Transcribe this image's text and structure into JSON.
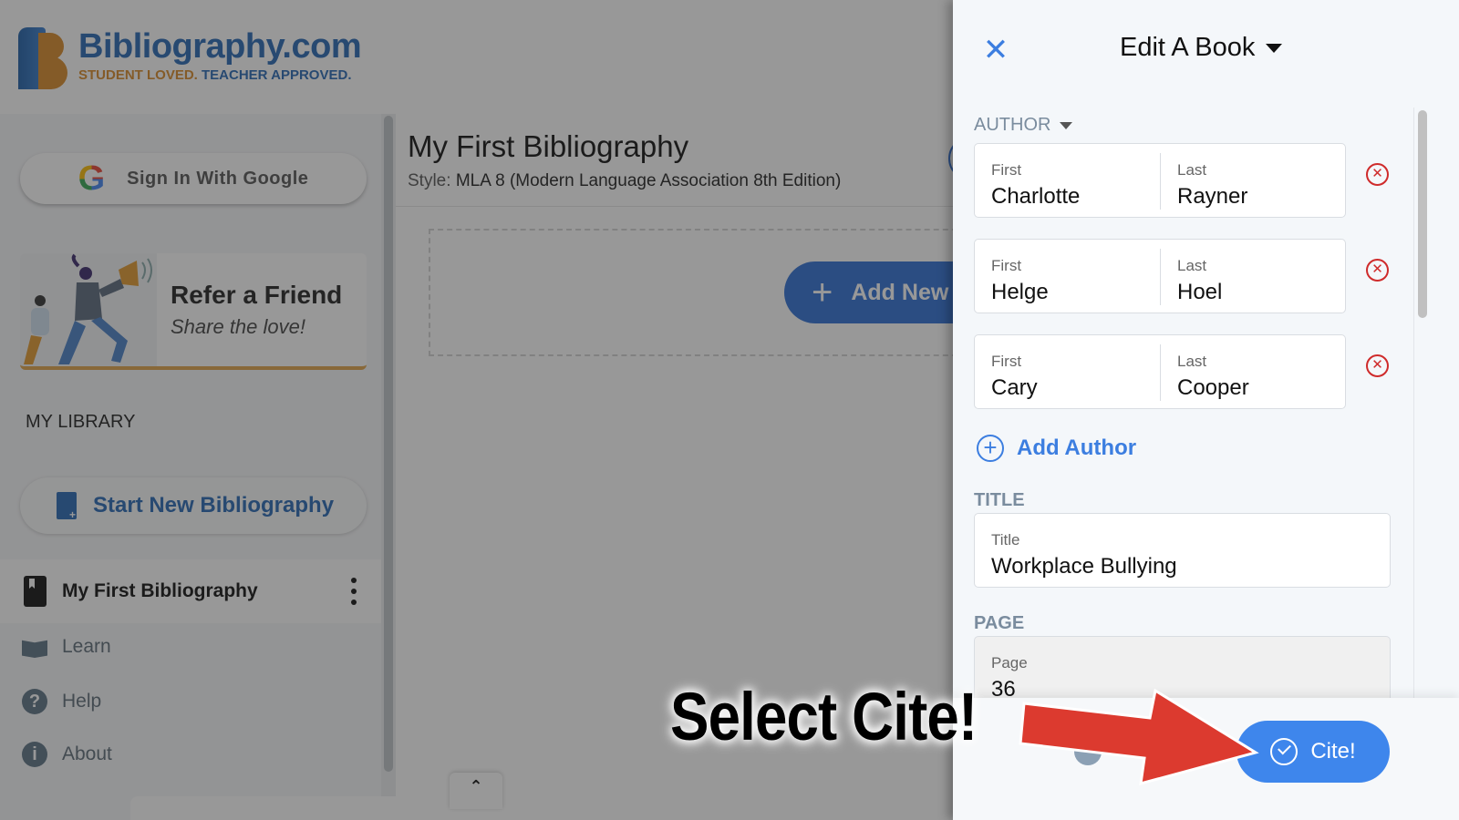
{
  "header": {
    "logo_title": "Bibliography.com",
    "logo_tagline_part1": "STUDENT LOVED.",
    "logo_tagline_part2": "TEACHER APPROVED."
  },
  "sidebar": {
    "google_signin_label": "Sign In With Google",
    "refer": {
      "title": "Refer a Friend",
      "subtitle": "Share the love!"
    },
    "library_label": "MY LIBRARY",
    "start_new_label": "Start New Bibliography",
    "bibliographies": [
      {
        "label": "My First Bibliography"
      }
    ],
    "nav": [
      {
        "label": "Learn",
        "icon": "book-reader-icon"
      },
      {
        "label": "Help",
        "icon": "question-circle-icon",
        "glyph": "?"
      },
      {
        "label": "About",
        "icon": "info-circle-icon",
        "glyph": "i"
      }
    ]
  },
  "main": {
    "title": "My First Bibliography",
    "style_key": "Style:",
    "style_value": "MLA 8 (Modern Language Association 8th Edition)",
    "add_new_label": "Add New Citation",
    "add_new_icon": "+",
    "scroll_top_glyph": "⌃"
  },
  "panel": {
    "close_glyph": "✕",
    "title": "Edit A Book",
    "author_section_label": "AUTHOR",
    "authors": [
      {
        "first_label": "First",
        "first": "Charlotte",
        "last_label": "Last",
        "last": "Rayner"
      },
      {
        "first_label": "First",
        "first": "Helge",
        "last_label": "Last",
        "last": "Hoel"
      },
      {
        "first_label": "First",
        "first": "Cary",
        "last_label": "Last",
        "last": "Cooper"
      }
    ],
    "remove_glyph": "✕",
    "add_author_label": "Add Author",
    "add_author_glyph": "+",
    "title_section_label": "TITLE",
    "title_field_label": "Title",
    "title_value": "Workplace Bullying",
    "page_section_label": "PAGE",
    "page_field_label": "Page",
    "page_value": "36",
    "cite_label": "Cite!"
  },
  "annotation": {
    "text": "Select Cite!",
    "arrow_color": "#dc3a2f"
  },
  "colors": {
    "brand_blue": "#2868b4",
    "brand_orange": "#d98b2a",
    "accent_blue": "#3e86ec",
    "remove_red": "#cf2b2b",
    "section_label": "#7a8c9e"
  }
}
